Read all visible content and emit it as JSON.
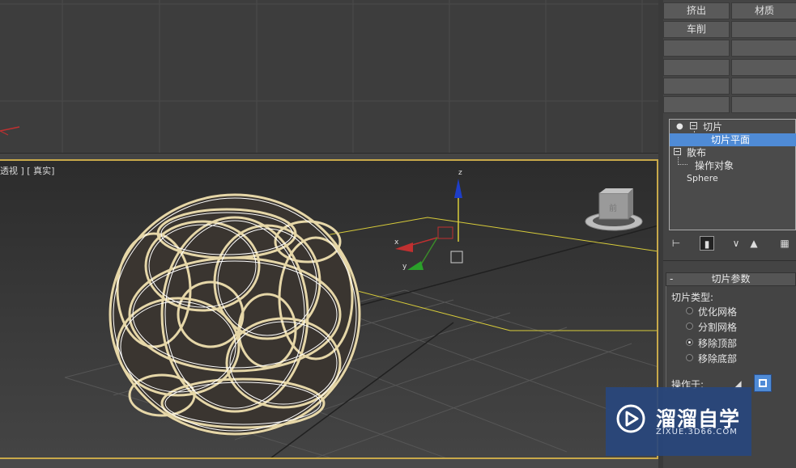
{
  "modifier_buttons": {
    "extrude": "挤出",
    "material": "材质",
    "lathe": "车削"
  },
  "viewport": {
    "label": "透视 ] [ 真实]",
    "gizmo_axis_z": "z",
    "gizmo_axis_x": "x",
    "gizmo_axis_y": "y",
    "viewcube_face": "前"
  },
  "modifier_stack": {
    "items": [
      {
        "label": "切片",
        "level": 0,
        "selected": false
      },
      {
        "label": "切片平面",
        "level": 1,
        "selected": true
      },
      {
        "label": "散布",
        "level": 0,
        "selected": false
      },
      {
        "label": "操作对象",
        "level": 1,
        "selected": false
      },
      {
        "label": "Sphere",
        "level": 0,
        "selected": false
      }
    ]
  },
  "slice_params": {
    "rollout_title": "切片参数",
    "slice_type_label": "切片类型:",
    "options": [
      {
        "label": "优化网格",
        "checked": false
      },
      {
        "label": "分割网格",
        "checked": false
      },
      {
        "label": "移除顶部",
        "checked": true
      },
      {
        "label": "移除底部",
        "checked": false
      }
    ],
    "operate_on_label": "操作于:"
  },
  "watermark": {
    "title": "溜溜自学",
    "url": "ZIXUE.3D66.COM"
  },
  "colors": {
    "accent_selected": "#4f8bd6",
    "viewport_border": "#c8a94a",
    "wire_object": "#e6d7a8",
    "gizmo_plane": "#d8cc3a"
  }
}
